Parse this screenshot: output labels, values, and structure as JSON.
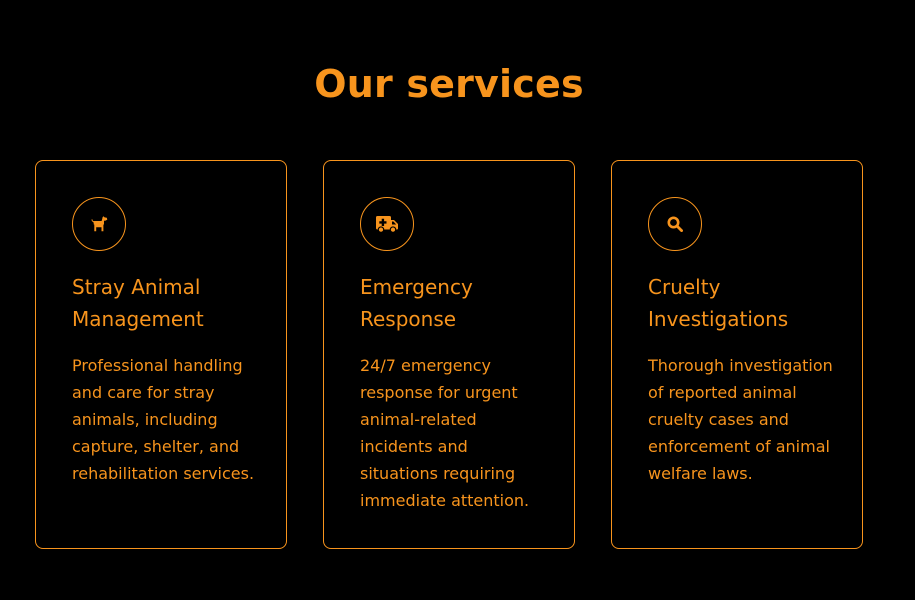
{
  "page": {
    "title": "Our services",
    "accent_color": "#f7941d",
    "background_color": "#000000"
  },
  "services": [
    {
      "icon": "dog-icon",
      "title": "Stray Animal Management",
      "description": "Professional handling and care for stray animals, including capture, shelter, and rehabilitation services."
    },
    {
      "icon": "ambulance-icon",
      "title": "Emergency Response",
      "description": "24/7 emergency response for urgent animal-related incidents and situations requiring immediate attention."
    },
    {
      "icon": "search-icon",
      "title": "Cruelty Investigations",
      "description": "Thorough investigation of reported animal cruelty cases and enforcement of animal welfare laws."
    }
  ]
}
